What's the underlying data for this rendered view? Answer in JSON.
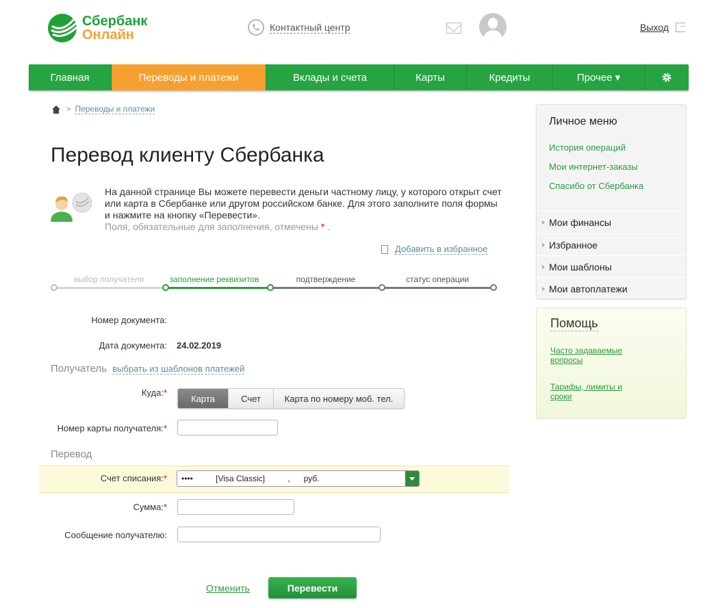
{
  "header": {
    "logo_line1": "Сбербанк",
    "logo_line2": "Онлайн",
    "contact_label": "Контактный центр",
    "logout_label": "Выход"
  },
  "nav": {
    "items": [
      {
        "label": "Главная",
        "active": false
      },
      {
        "label": "Переводы и платежи",
        "active": true
      },
      {
        "label": "Вклады и счета",
        "active": false
      },
      {
        "label": "Карты",
        "active": false
      },
      {
        "label": "Кредиты",
        "active": false
      },
      {
        "label": "Прочее ▾",
        "active": false
      }
    ]
  },
  "breadcrumb": {
    "current": "Переводы и платежи"
  },
  "page": {
    "title": "Перевод клиенту Сбербанка",
    "intro": "На данной странице Вы можете перевести деньги частному лицу, у которого открыт счет или карта в Сбербанке или другом российском банке. Для этого заполните поля формы и нажмите на кнопку «Перевести».",
    "intro_note": "Поля, обязательные для заполнения, отмечены",
    "required_mark": "*",
    "intro_note_end": ".",
    "favorite_label": "Добавить в избранное"
  },
  "steps": [
    {
      "label": "выбор получателя",
      "state": "done"
    },
    {
      "label": "заполнение реквизитов",
      "state": "current"
    },
    {
      "label": "подтверждение",
      "state": "todo"
    },
    {
      "label": "статус операции",
      "state": "todo"
    }
  ],
  "form": {
    "doc_number_label": "Номер документа:",
    "doc_number_value": "",
    "doc_date_label": "Дата документа:",
    "doc_date_value": "24.02.2019",
    "recipient_section": "Получатель",
    "recipient_template_link": "выбрать из шаблонов платежей",
    "where_label": "Куда:",
    "where_options": [
      "Карта",
      "Счет",
      "Карта по номеру моб. тел."
    ],
    "where_selected": "Карта",
    "card_number_label": "Номер карты получателя:",
    "card_number_value": "",
    "transfer_section": "Перевод",
    "account_label": "Счет списания:",
    "account_value": "••••          [Visa Classic]          ,      руб.",
    "amount_label": "Сумма:",
    "amount_value": "",
    "message_label": "Сообщение получателю:",
    "message_value": "",
    "cancel_label": "Отменить",
    "submit_label": "Перевести"
  },
  "sidebar": {
    "personal_menu_title": "Личное меню",
    "links": [
      "История операций",
      "Мои интернет-заказы",
      "Спасибо от Сбербанка"
    ],
    "rows": [
      "Мои финансы",
      "Избранное",
      "Мои шаблоны",
      "Мои автоплатежи"
    ]
  },
  "help": {
    "title": "Помощь",
    "links": [
      "Часто задаваемые вопросы",
      "Тарифы, лимиты и сроки"
    ]
  },
  "colors": {
    "brand_green": "#26a442",
    "active_orange": "#f6a02f",
    "link_green": "#2a9a3e"
  }
}
